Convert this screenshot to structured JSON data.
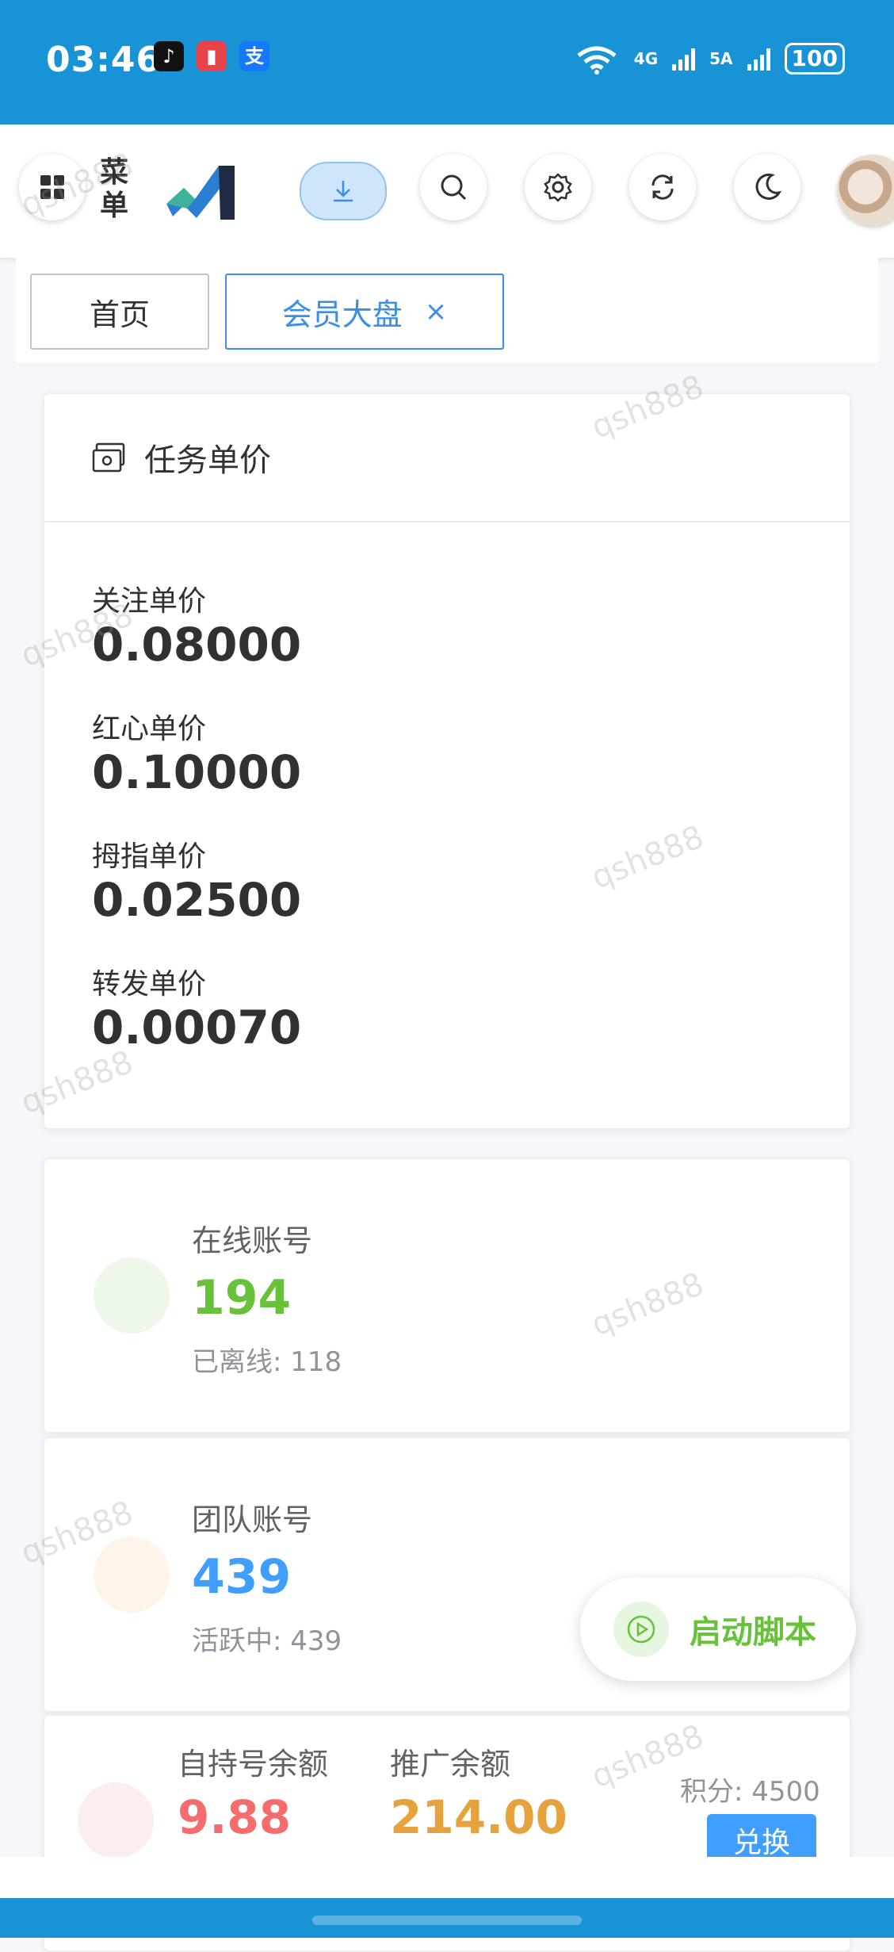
{
  "status_bar": {
    "time": "03:46",
    "apps": [
      "tiktok-icon",
      "book-app-icon",
      "alipay-icon"
    ],
    "alipay_glyph": "支",
    "wifi_label": "6",
    "net1": "4G",
    "net2": "5A",
    "battery": "100"
  },
  "header": {
    "menu_label": "菜单",
    "logo": "logo-icon"
  },
  "tabs": [
    {
      "label": "首页"
    },
    {
      "label": "会员大盘",
      "close": "×"
    }
  ],
  "price_card": {
    "title": "任务单价",
    "items": [
      {
        "label": "关注单价",
        "value": "0.08000"
      },
      {
        "label": "红心单价",
        "value": "0.10000"
      },
      {
        "label": "拇指单价",
        "value": "0.02500"
      },
      {
        "label": "转发单价",
        "value": "0.00070"
      }
    ]
  },
  "online_card": {
    "label": "在线账号",
    "value": "194",
    "sub": "已离线: 118",
    "color": "#67c23a",
    "dot_color": "#eef8ea"
  },
  "team_card": {
    "label": "团队账号",
    "value": "439",
    "sub": "活跃中: 439",
    "color": "#409eff",
    "dot_color": "#fdf4ea"
  },
  "balance_card": {
    "self_label": "自持号余额",
    "self_value": "9.88",
    "self_color": "#f56c6c",
    "promo_label": "推广余额",
    "promo_value": "214.00",
    "promo_color": "#e6a23c",
    "points": "积分: 4500",
    "exchange_label": "兑换"
  },
  "fab": {
    "label": "启动脚本"
  },
  "watermark": "qsh888"
}
